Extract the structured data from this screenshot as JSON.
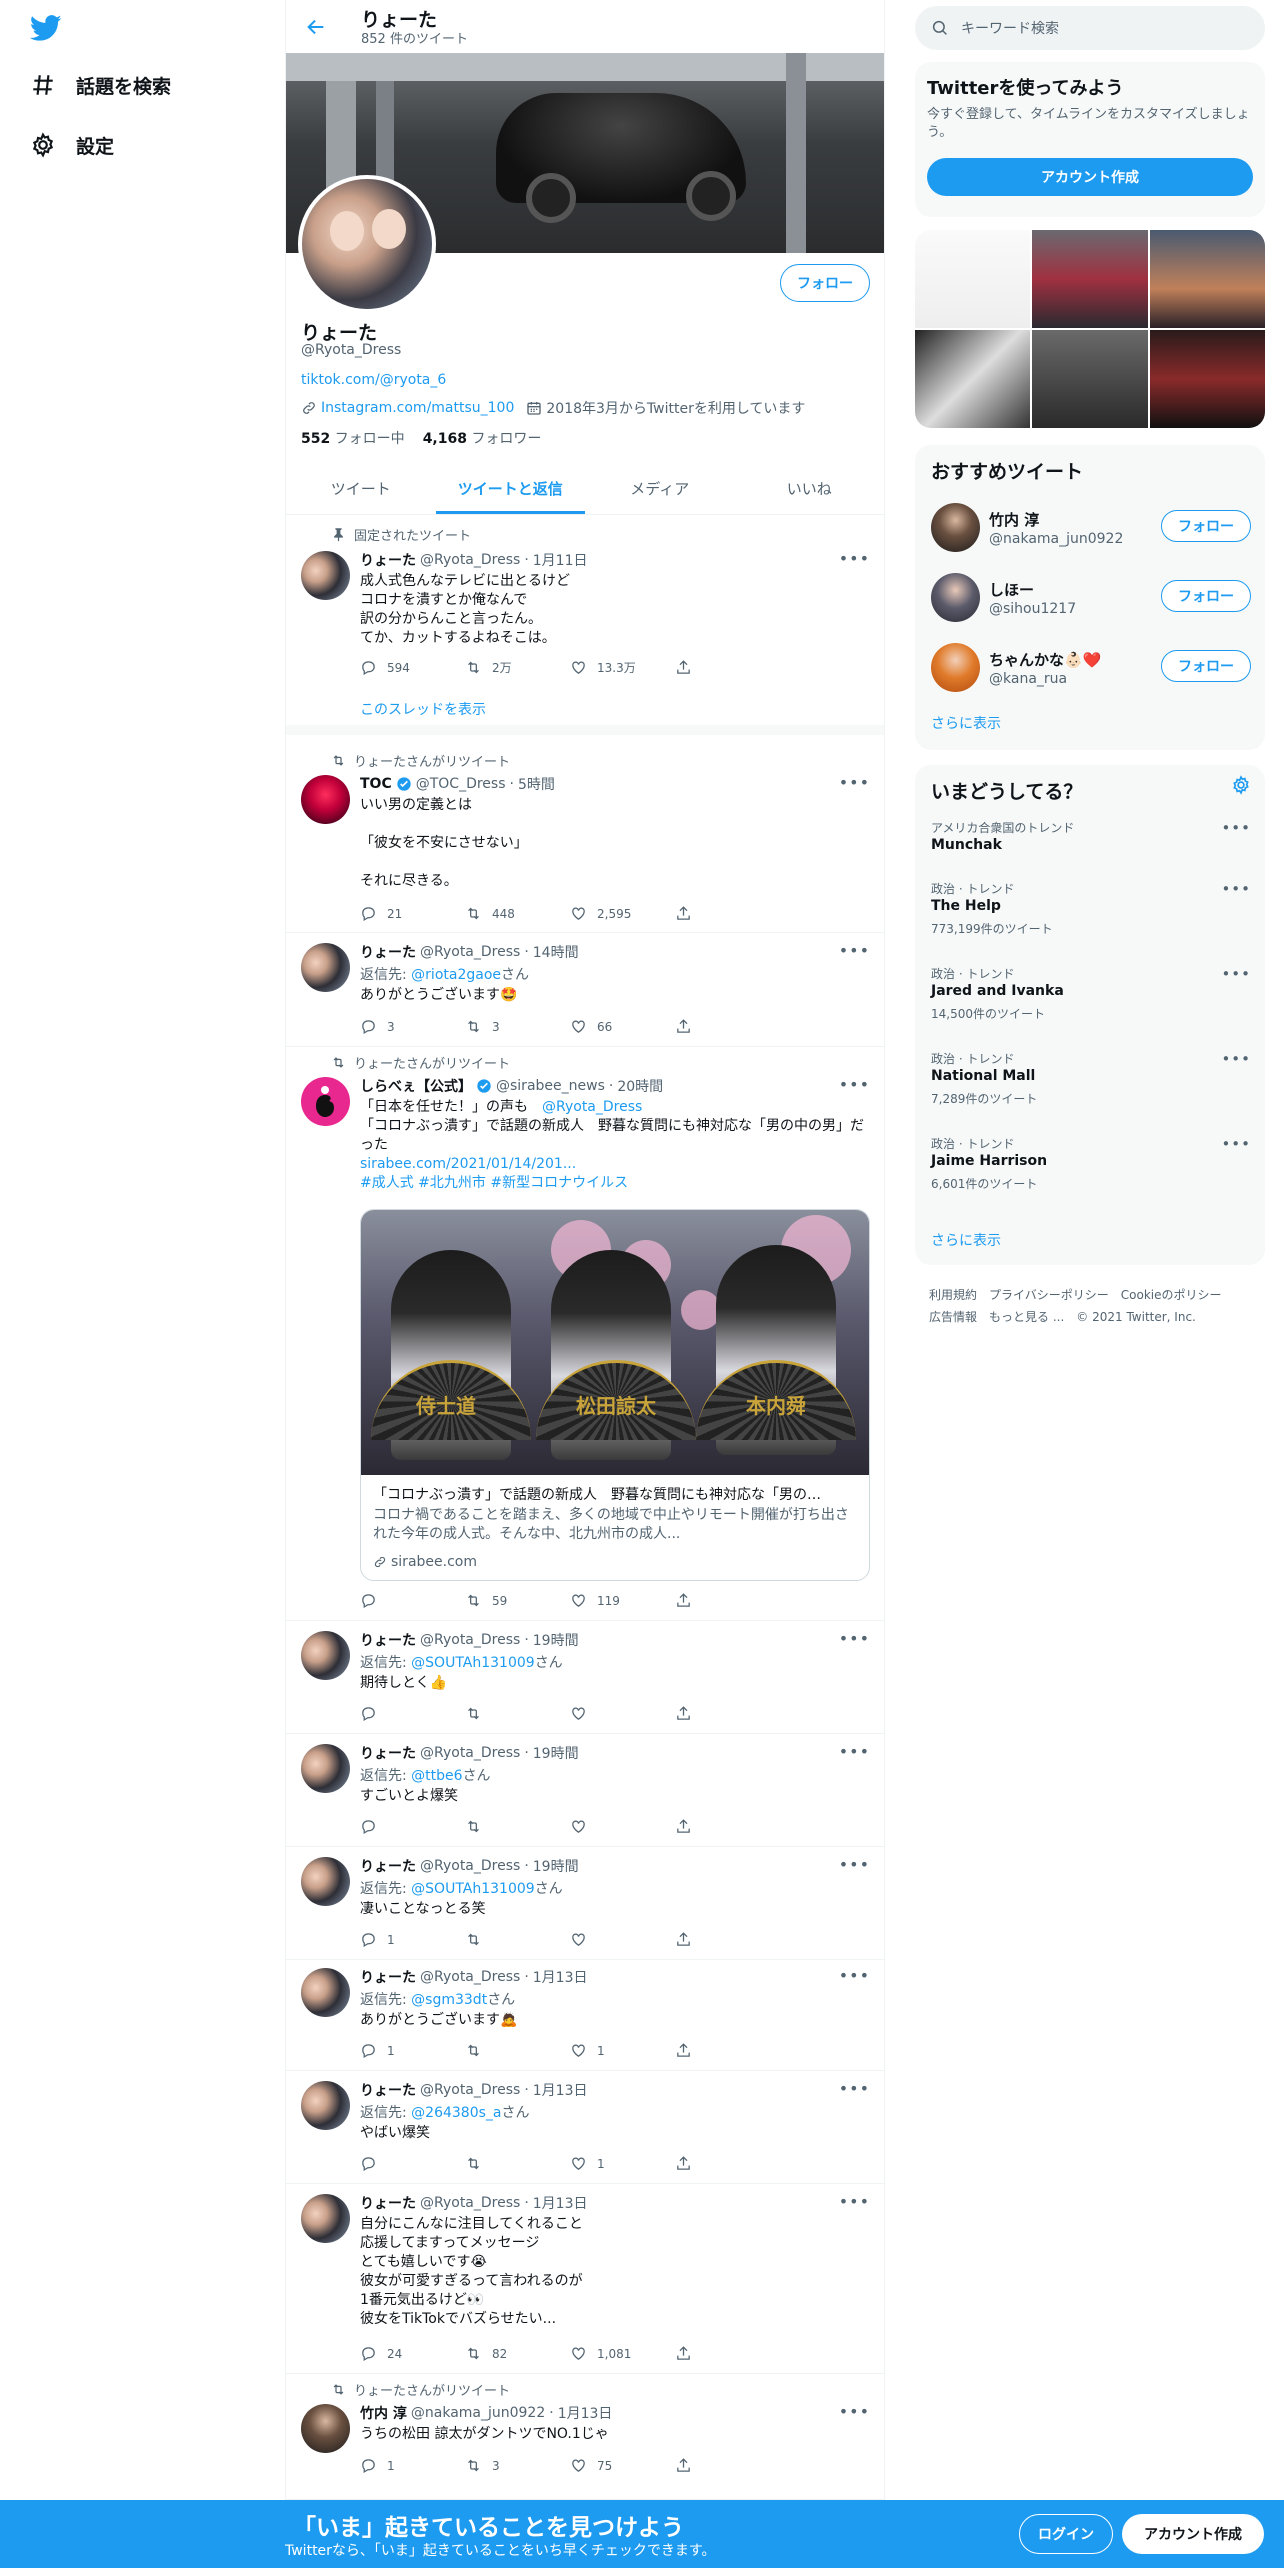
{
  "nav": {
    "explore": "話題を検索",
    "settings": "設定"
  },
  "header": {
    "name": "りょーた",
    "tweet_count": "852 件のツイート"
  },
  "profile": {
    "name": "りょーた",
    "handle": "@Ryota_Dress",
    "bio": "tiktok.com/@ryota_6",
    "link": "Instagram.com/mattsu_100",
    "joined": "2018年3月からTwitterを利用しています",
    "following_count": "552",
    "following_label": "フォロー中",
    "followers_count": "4,168",
    "followers_label": "フォロワー",
    "follow_label": "フォロー"
  },
  "tabs": [
    "ツイート",
    "ツイートと返信",
    "メディア",
    "いいね"
  ],
  "tweets": [
    {
      "social": "固定されたツイート",
      "name": "りょーた",
      "handle": "@Ryota_Dress",
      "time": "1月11日",
      "text": "成人式色んなテレビに出とるけど\nコロナを潰すとか俺なんで\n訳の分からんこと言ったん。\nてか、カットするよねそこは。",
      "reply": "594",
      "retweet": "2万",
      "like": "13.3万",
      "show_thread": "このスレッドを表示"
    },
    {
      "social": "りょーたさんがリツイート",
      "name": "TOC",
      "handle": "@TOC_Dress",
      "time": "5時間",
      "text": "いい男の定義とは\n\n「彼女を不安にさせない」\n\nそれに尽きる。",
      "reply": "21",
      "retweet": "448",
      "like": "2,595"
    },
    {
      "name": "りょーた",
      "handle": "@Ryota_Dress",
      "time": "14時間",
      "reply_label": "返信先:",
      "reply_to": "@riota2gaoe",
      "reply_suffix": "さん",
      "text": "ありがとうございます🤩",
      "reply": "3",
      "retweet": "3",
      "like": "66"
    },
    {
      "social": "りょーたさんがリツイート",
      "name": "しらべぇ【公式】",
      "handle": "@sirabee_news",
      "time": "20時間",
      "text_a": "「日本を任せた！」の声も　",
      "mention": "@Ryota_Dress",
      "text_b": "「コロナぶっ潰す」で話題の新成人　野暮な質問にも神対応な「男の中の男」だった",
      "url": "sirabee.com/2021/01/14/201...",
      "hashtags": "#成人式 #北九州市 #新型コロナウイルス",
      "card_title": "「コロナぶっ潰す」で話題の新成人　野暮な質問にも神対応な「男の…",
      "card_desc": "コロナ禍であることを踏まえ、多くの地域で中止やリモート開催が打ち出された今年の成人式。そんな中、北九州市の成人...",
      "card_domain": "sirabee.com",
      "card_text_1": "侍士道",
      "card_text_2": "松田諒太",
      "card_text_3": "本内舜",
      "reply": "",
      "retweet": "59",
      "like": "119"
    },
    {
      "name": "りょーた",
      "handle": "@Ryota_Dress",
      "time": "19時間",
      "reply_label": "返信先:",
      "reply_to": "@SOUTAh131009",
      "reply_suffix": "さん",
      "text": "期待しとく👍",
      "reply": "",
      "retweet": "",
      "like": ""
    },
    {
      "name": "りょーた",
      "handle": "@Ryota_Dress",
      "time": "19時間",
      "reply_label": "返信先:",
      "reply_to": "@ttbe6",
      "reply_suffix": "さん",
      "text": "すごいとよ爆笑",
      "reply": "",
      "retweet": "",
      "like": ""
    },
    {
      "name": "りょーた",
      "handle": "@Ryota_Dress",
      "time": "19時間",
      "reply_label": "返信先:",
      "reply_to": "@SOUTAh131009",
      "reply_suffix": "さん",
      "text": "凄いことなっとる笑",
      "reply": "1",
      "retweet": "",
      "like": ""
    },
    {
      "name": "りょーた",
      "handle": "@Ryota_Dress",
      "time": "1月13日",
      "reply_label": "返信先:",
      "reply_to": "@sgm33dt",
      "reply_suffix": "さん",
      "text": "ありがとうございます🙇",
      "reply": "1",
      "retweet": "",
      "like": "1"
    },
    {
      "name": "りょーた",
      "handle": "@Ryota_Dress",
      "time": "1月13日",
      "reply_label": "返信先:",
      "reply_to": "@264380s_a",
      "reply_suffix": "さん",
      "text": "やばい爆笑",
      "reply": "",
      "retweet": "",
      "like": "1"
    },
    {
      "name": "りょーた",
      "handle": "@Ryota_Dress",
      "time": "1月13日",
      "text": "自分にこんなに注目してくれること\n応援してますってメッセージ\nとても嬉しいです😭\n彼女が可愛すぎるって言われるのが\n1番元気出るけど👀\n彼女をTikTokでバズらせたい...",
      "reply": "24",
      "retweet": "82",
      "like": "1,081"
    },
    {
      "social": "りょーたさんがリツイート",
      "name": "竹内 淳",
      "handle": "@nakama_jun0922",
      "time": "1月13日",
      "text": "うちの松田 諒太がダントツでNO.1じゃ",
      "reply": "1",
      "retweet": "3",
      "like": "75"
    }
  ],
  "right": {
    "search_placeholder": "キーワード検索",
    "signup_title": "Twitterを使ってみよう",
    "signup_desc": "今すぐ登録して、タイムラインをカスタマイズしましょう。",
    "signup_button": "アカウント作成",
    "who_title": "おすすめツイート",
    "who": [
      {
        "name": "竹内 淳",
        "handle": "@nakama_jun0922",
        "button": "フォロー"
      },
      {
        "name": "しほー",
        "handle": "@sihou1217",
        "button": "フォロー"
      },
      {
        "name": "ちゃんかな👶🏻❤️",
        "handle": "@kana_rua",
        "button": "フォロー"
      }
    ],
    "who_more": "さらに表示",
    "trends_title": "いまどうしてる？",
    "trends": [
      {
        "category": "アメリカ合衆国のトレンド",
        "topic": "Munchak",
        "count": ""
      },
      {
        "category": "政治 · トレンド",
        "topic": "The Help",
        "count": "773,199件のツイート"
      },
      {
        "category": "政治 · トレンド",
        "topic": "Jared and Ivanka",
        "count": "14,500件のツイート"
      },
      {
        "category": "政治 · トレンド",
        "topic": "National Mall",
        "count": "7,289件のツイート"
      },
      {
        "category": "政治 · トレンド",
        "topic": "Jaime Harrison",
        "count": "6,601件のツイート"
      }
    ],
    "trends_more": "さらに表示",
    "footer": [
      "利用規約",
      "プライバシーポリシー",
      "Cookieのポリシー",
      "広告情報",
      "もっと見る ...",
      "© 2021 Twitter, Inc."
    ]
  },
  "bottom_bar": {
    "title": "「いま」起きていることを見つけよう",
    "subtitle": "Twitterなら、「いま」起きていることをいち早くチェックできます。",
    "login": "ログイン",
    "signup": "アカウント作成"
  },
  "colors": {
    "accent": "#1d9bf0",
    "text": "#0f1419",
    "muted": "#536471"
  }
}
